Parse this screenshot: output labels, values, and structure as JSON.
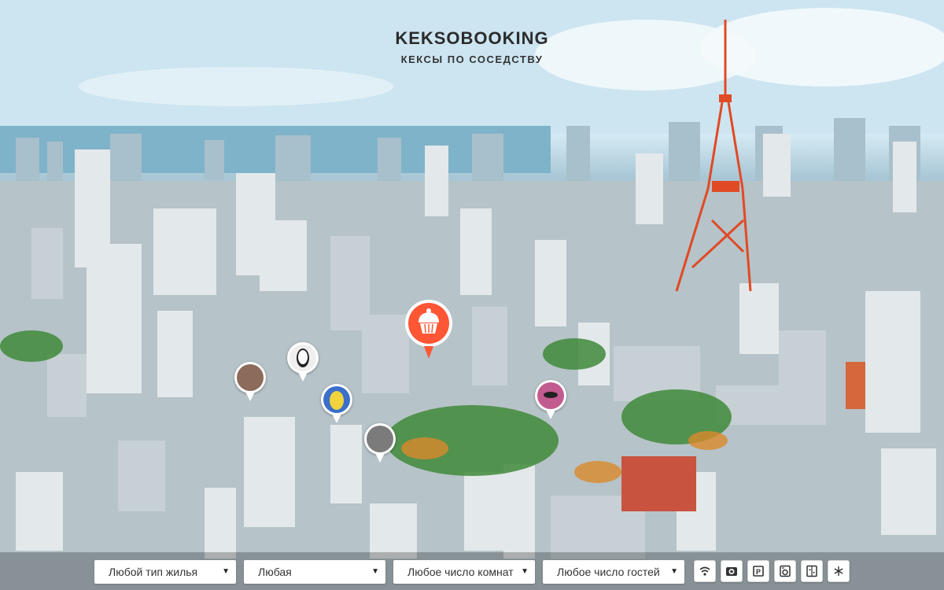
{
  "header": {
    "logo": "KEKSOBOOKING",
    "tagline": "КЕКСЫ ПО СОСЕДСТВУ"
  },
  "main_pin": {
    "icon": "cupcake-icon",
    "color": "#ff5635"
  },
  "pins": [
    {
      "name": "map-pin-1",
      "avatar_color": "#8c6b5a",
      "avatar_icon": "user-avatar"
    },
    {
      "name": "map-pin-2",
      "avatar_color": "#efefef",
      "avatar_icon": "user-avatar"
    },
    {
      "name": "map-pin-3",
      "avatar_color": "#f0d33d",
      "avatar_icon": "user-avatar"
    },
    {
      "name": "map-pin-4",
      "avatar_color": "#7b7b7b",
      "avatar_icon": "user-avatar"
    },
    {
      "name": "map-pin-5",
      "avatar_color": "#c25b8f",
      "avatar_icon": "user-avatar"
    }
  ],
  "filters": {
    "housing_type": "Любой тип жилья",
    "price": "Любая",
    "rooms": "Любое число комнат",
    "guests": "Любое число гостей"
  },
  "features": [
    {
      "name": "wifi-feature",
      "icon": "wifi-icon"
    },
    {
      "name": "dishwasher-feature",
      "icon": "dishwasher-icon"
    },
    {
      "name": "parking-feature",
      "icon": "parking-icon"
    },
    {
      "name": "washer-feature",
      "icon": "washer-icon"
    },
    {
      "name": "elevator-feature",
      "icon": "elevator-icon"
    },
    {
      "name": "conditioner-feature",
      "icon": "snowflake-icon"
    }
  ]
}
